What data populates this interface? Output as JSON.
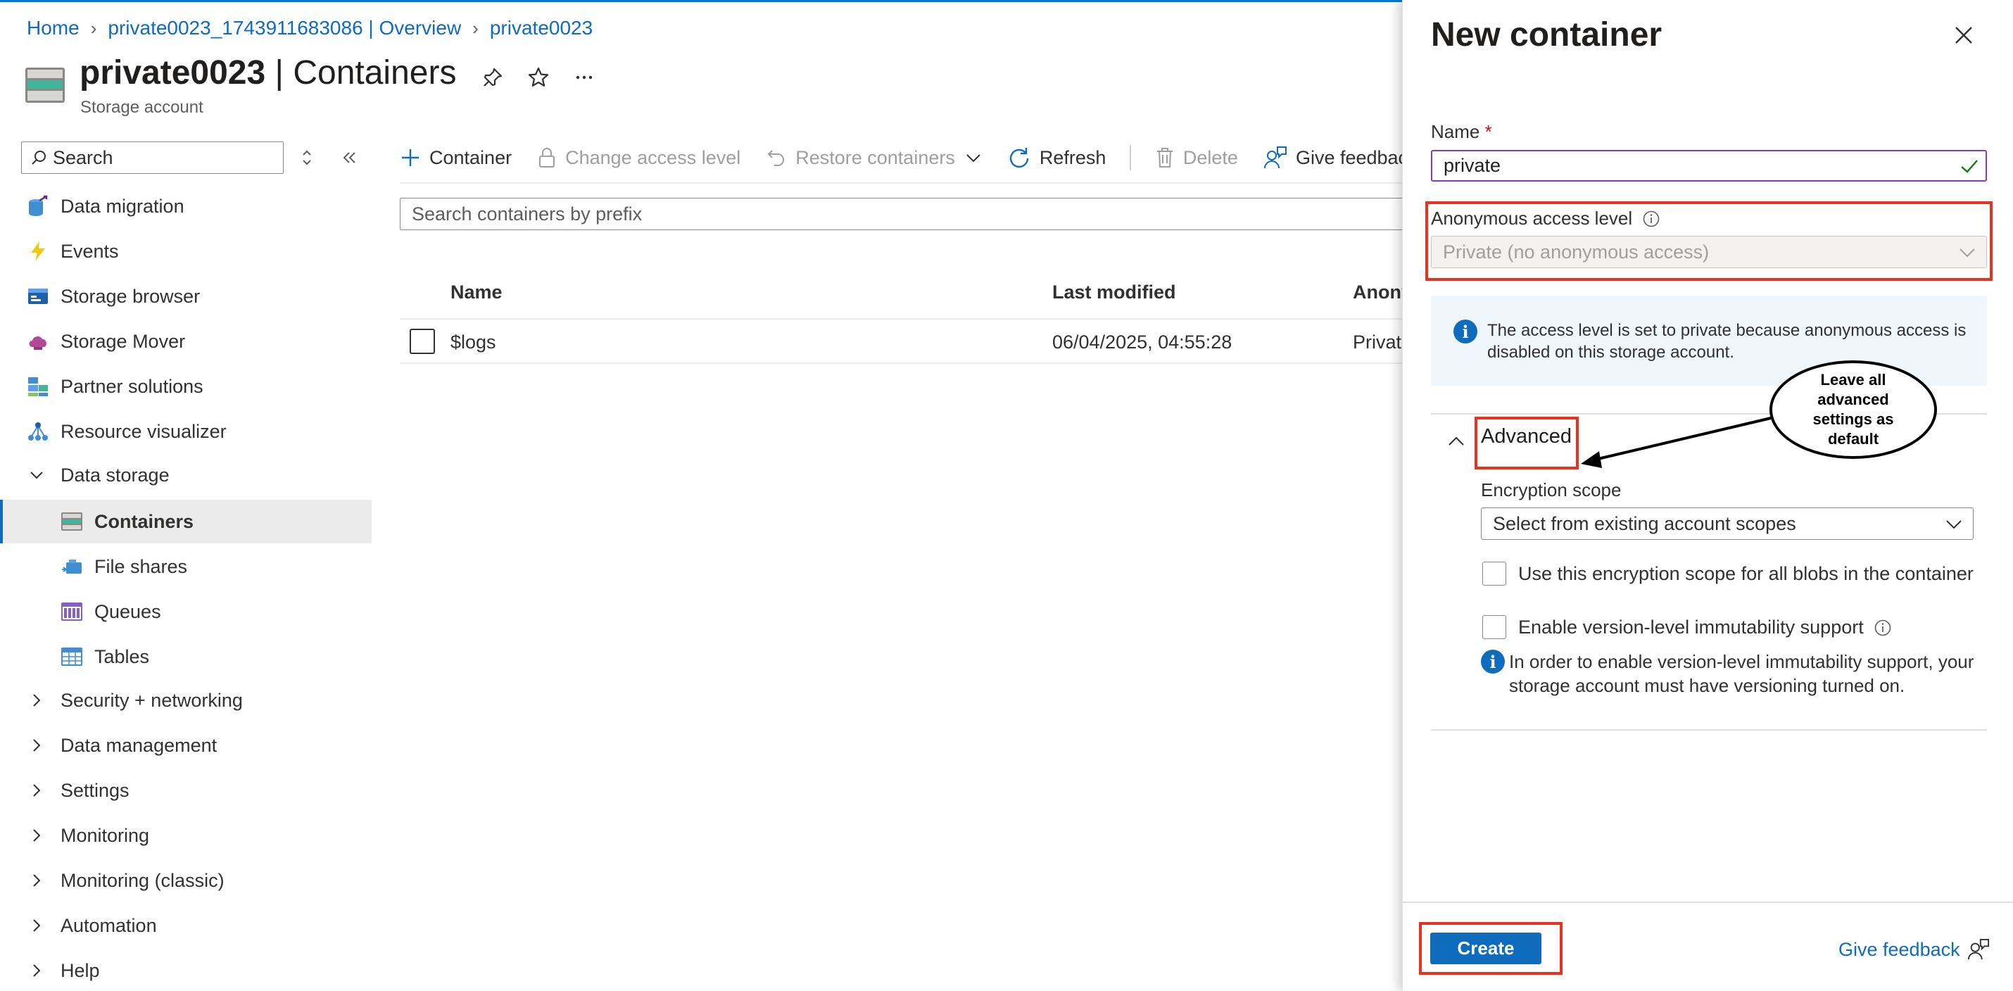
{
  "breadcrumb": [
    "Home",
    "private0023_1743911683086 | Overview",
    "private0023"
  ],
  "page": {
    "title_name": "private0023",
    "title_section": " | Containers",
    "subtitle": "Storage account"
  },
  "sidebar": {
    "search_placeholder": "Search",
    "items": [
      {
        "label": "Data migration",
        "icon": "data-migration-icon"
      },
      {
        "label": "Events",
        "icon": "events-icon"
      },
      {
        "label": "Storage browser",
        "icon": "storage-browser-icon"
      },
      {
        "label": "Storage Mover",
        "icon": "storage-mover-icon"
      },
      {
        "label": "Partner solutions",
        "icon": "partner-solutions-icon"
      },
      {
        "label": "Resource visualizer",
        "icon": "resource-visualizer-icon"
      }
    ],
    "data_storage": {
      "label": "Data storage",
      "children": [
        "Containers",
        "File shares",
        "Queues",
        "Tables"
      ],
      "selected": "Containers"
    },
    "groups": [
      "Security + networking",
      "Data management",
      "Settings",
      "Monitoring",
      "Monitoring (classic)",
      "Automation",
      "Help"
    ]
  },
  "toolbar": {
    "container": "Container",
    "change_access": "Change access level",
    "restore": "Restore containers",
    "refresh": "Refresh",
    "delete": "Delete",
    "feedback": "Give feedback"
  },
  "containers": {
    "search_placeholder": "Search containers by prefix",
    "columns": [
      "Name",
      "Last modified",
      "Anony"
    ],
    "rows": [
      {
        "name": "$logs",
        "last_modified": "06/04/2025, 04:55:28",
        "access": "Private"
      }
    ]
  },
  "panel": {
    "title": "New container",
    "name_label": "Name",
    "required_mark": "*",
    "name_value": "private",
    "access_label": "Anonymous access level",
    "access_value": "Private (no anonymous access)",
    "info_text": "The access level is set to private because anonymous access is disabled on this storage account.",
    "advanced_label": "Advanced",
    "encryption_label": "Encryption scope",
    "encryption_placeholder": "Select from existing account scopes",
    "cb_scope_label": "Use this encryption scope for all blobs in the container",
    "cb_immutability_label": "Enable version-level immutability support",
    "immutability_note": "In order to enable version-level immutability support, your storage account must have versioning turned on.",
    "create_label": "Create",
    "feedback_label": "Give feedback"
  },
  "annotation": {
    "callout_text": "Leave all advanced settings as default",
    "highlight_color": "#e8321e"
  },
  "colors": {
    "accent": "#0f6cbd",
    "valid_check": "#107c10",
    "name_border": "#8a3ab9"
  }
}
